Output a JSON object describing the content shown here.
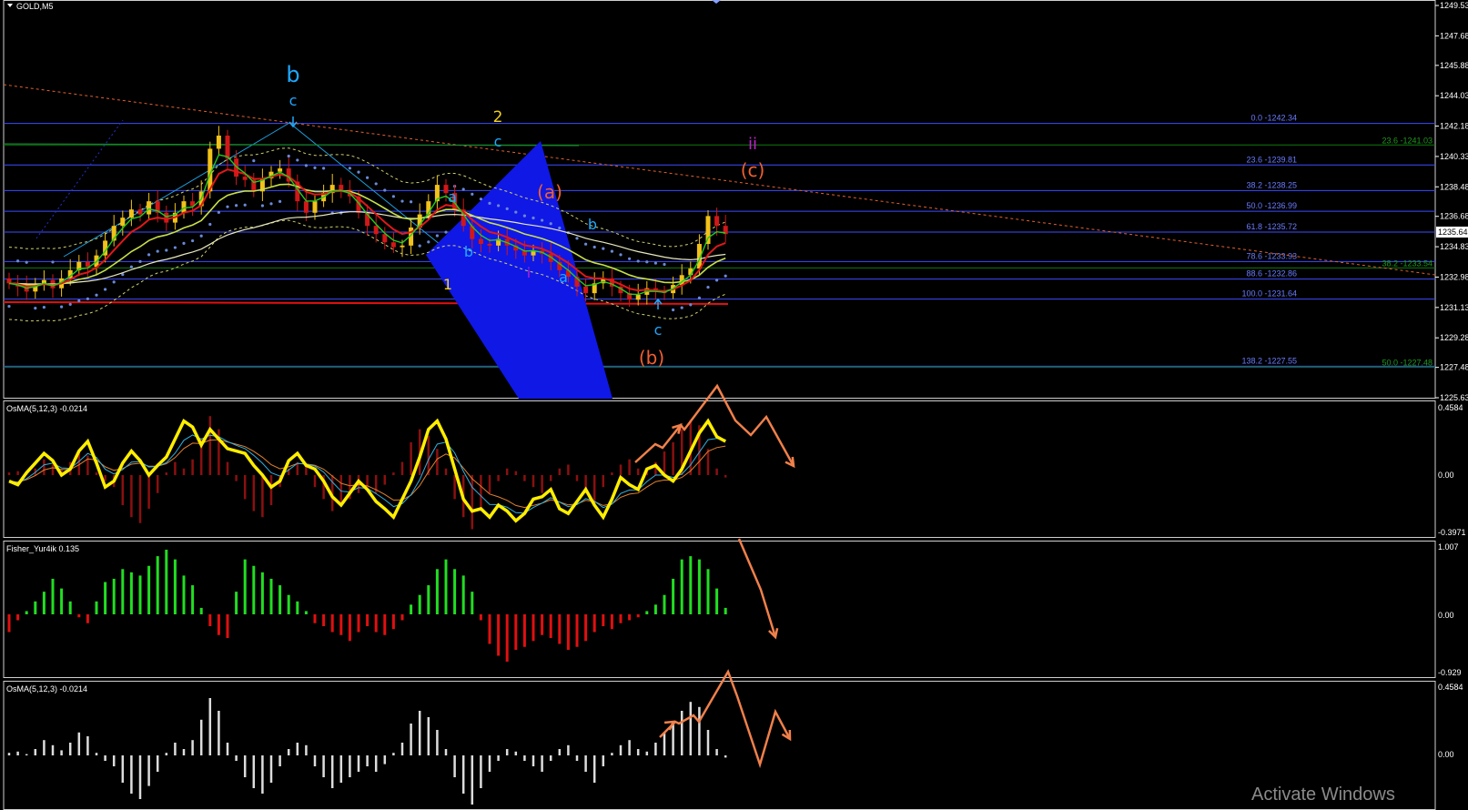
{
  "symbol_title": "GOLD,M5",
  "watermark": "Activate Windows",
  "colors": {
    "bull": "#f2c21a",
    "bear": "#d11818",
    "fib": "#3c4cff",
    "fib2": "#0f7a0f",
    "wedge": "#1018e6",
    "arrow": "#f0804a"
  },
  "main_pane": {
    "price_axis": [
      "1249.53",
      "1247.68",
      "1245.88",
      "1244.03",
      "1242.18",
      "1240.33",
      "1238.48",
      "1236.68",
      "1234.83",
      "1232.98",
      "1231.13",
      "1229.28",
      "1227.48",
      "1225.63"
    ],
    "current_price": "1235.64",
    "fib_levels": [
      {
        "label": "0.0 -1242.34",
        "price": 1242.34
      },
      {
        "label": "23.6 -1239.81",
        "price": 1239.81
      },
      {
        "label": "38.2 -1238.25",
        "price": 1238.25
      },
      {
        "label": "50.0 -1236.99",
        "price": 1236.99
      },
      {
        "label": "61.8 -1235.72",
        "price": 1235.72
      },
      {
        "label": "78.6 -1233.93",
        "price": 1233.93
      },
      {
        "label": "88.6 -1232.86",
        "price": 1232.86
      },
      {
        "label": "100.0 -1231.64",
        "price": 1231.64
      },
      {
        "label": "138.2 -1227.55",
        "price": 1227.55
      }
    ],
    "fib2_levels": [
      {
        "label": "23.6 -1241.03",
        "price": 1241.03
      },
      {
        "label": "38.2 -1233.54",
        "price": 1233.54
      },
      {
        "label": "50.0 -1227.48",
        "price": 1227.48
      }
    ],
    "wave_labels": {
      "b_big": "b",
      "c1": "c",
      "two": "2",
      "c2": "c",
      "a1": "a",
      "a_paren": "(a)",
      "b1": "b",
      "b2": "b",
      "i1": "i",
      "a2": "a",
      "one": "1",
      "ii": "ii",
      "c_paren": "(c)",
      "c3": "c",
      "b_paren": "(b)"
    }
  },
  "osma1": {
    "title": "OsMA(5,12,3) -0.0214",
    "axis": [
      "0.4584",
      "0.00",
      "-0.3971"
    ]
  },
  "fisher": {
    "title": "Fisher_Yur4ik 0.135",
    "axis": [
      "1.007",
      "0.00",
      "-0.929"
    ]
  },
  "osma2": {
    "title": "OsMA(5,12,3) -0.0214",
    "axis": [
      "0.4584",
      "0.00",
      "-0.3971"
    ]
  },
  "chart_data": {
    "type": "candlestick",
    "title": "GOLD,M5",
    "ylim": [
      1225.63,
      1249.53
    ],
    "close": [
      1232.6,
      1232.4,
      1232.1,
      1232.5,
      1232.8,
      1232.3,
      1232.9,
      1233.4,
      1233.9,
      1233.6,
      1234.3,
      1235.2,
      1236.1,
      1236.6,
      1237.1,
      1236.8,
      1237.6,
      1236.9,
      1236.3,
      1236.9,
      1237.6,
      1237.3,
      1238.2,
      1240.8,
      1241.6,
      1240.2,
      1239.1,
      1238.9,
      1238.2,
      1239.0,
      1239.4,
      1239.6,
      1238.8,
      1237.6,
      1236.9,
      1237.6,
      1238.1,
      1238.6,
      1238.3,
      1237.9,
      1236.9,
      1236.1,
      1235.6,
      1235.1,
      1234.8,
      1234.9,
      1236.0,
      1236.8,
      1237.6,
      1238.6,
      1238.1,
      1237.1,
      1236.1,
      1235.3,
      1235.0,
      1234.9,
      1235.3,
      1234.9,
      1234.6,
      1234.3,
      1234.6,
      1234.4,
      1233.9,
      1233.4,
      1233.0,
      1232.4,
      1232.0,
      1232.6,
      1232.9,
      1232.4,
      1232.0,
      1231.6,
      1231.9,
      1232.3,
      1232.1,
      1232.0,
      1232.5,
      1233.1,
      1233.5,
      1235.0,
      1236.7,
      1236.1,
      1235.6
    ],
    "fib_levels": [
      1242.34,
      1239.81,
      1238.25,
      1236.99,
      1235.72,
      1233.93,
      1232.86,
      1231.64,
      1227.55
    ],
    "fisher_values": [
      -0.3,
      -0.1,
      0.05,
      0.2,
      0.35,
      0.55,
      0.4,
      0.2,
      -0.05,
      -0.15,
      0.2,
      0.5,
      0.55,
      0.7,
      0.65,
      0.6,
      0.75,
      0.9,
      1.0,
      0.85,
      0.6,
      0.45,
      0.1,
      -0.2,
      -0.35,
      -0.4,
      0.35,
      0.85,
      0.75,
      0.65,
      0.55,
      0.45,
      0.3,
      0.2,
      0.05,
      -0.15,
      -0.2,
      -0.3,
      -0.35,
      -0.45,
      -0.3,
      -0.2,
      -0.3,
      -0.35,
      -0.25,
      -0.1,
      0.15,
      0.3,
      0.45,
      0.7,
      0.85,
      0.7,
      0.6,
      0.35,
      -0.1,
      -0.5,
      -0.7,
      -0.8,
      -0.6,
      -0.55,
      -0.45,
      -0.35,
      -0.4,
      -0.5,
      -0.6,
      -0.55,
      -0.45,
      -0.3,
      -0.2,
      -0.25,
      -0.15,
      -0.1,
      -0.05,
      0.05,
      0.15,
      0.3,
      0.55,
      0.85,
      0.9,
      0.85,
      0.7,
      0.4,
      0.1
    ],
    "osma_hist": [
      0.02,
      0.03,
      0.01,
      0.05,
      0.12,
      0.08,
      0.04,
      0.1,
      0.18,
      0.15,
      0.02,
      -0.05,
      -0.1,
      -0.25,
      -0.35,
      -0.4,
      -0.28,
      -0.15,
      0.02,
      0.1,
      0.05,
      0.12,
      0.28,
      0.45,
      0.35,
      0.1,
      -0.05,
      -0.2,
      -0.3,
      -0.35,
      -0.25,
      -0.1,
      0.05,
      0.1,
      0.08,
      -0.1,
      -0.2,
      -0.3,
      -0.25,
      -0.2,
      -0.15,
      -0.1,
      -0.15,
      -0.08,
      0.02,
      0.1,
      0.25,
      0.35,
      0.3,
      0.2,
      0.05,
      -0.2,
      -0.35,
      -0.45,
      -0.3,
      -0.15,
      -0.05,
      0.05,
      0.03,
      -0.05,
      -0.1,
      -0.15,
      -0.05,
      0.05,
      0.08,
      -0.05,
      -0.15,
      -0.25,
      -0.1,
      0.02,
      0.08,
      0.12,
      0.05,
      0.03,
      0.1,
      0.18,
      0.25,
      0.35,
      0.42,
      0.38,
      0.2,
      0.05,
      -0.02
    ],
    "osma_line": [
      -0.05,
      -0.08,
      0.02,
      0.1,
      0.18,
      0.12,
      0.0,
      0.05,
      0.2,
      0.28,
      0.1,
      -0.1,
      -0.05,
      0.1,
      0.2,
      0.12,
      0.0,
      0.08,
      0.15,
      0.3,
      0.45,
      0.4,
      0.25,
      0.38,
      0.3,
      0.22,
      0.2,
      0.18,
      0.08,
      0.0,
      -0.1,
      -0.05,
      0.12,
      0.18,
      0.08,
      0.05,
      -0.05,
      -0.18,
      -0.25,
      -0.15,
      -0.05,
      -0.12,
      -0.22,
      -0.28,
      -0.35,
      -0.2,
      -0.05,
      0.15,
      0.38,
      0.45,
      0.3,
      0.05,
      -0.2,
      -0.3,
      -0.28,
      -0.35,
      -0.25,
      -0.3,
      -0.38,
      -0.32,
      -0.2,
      -0.18,
      -0.12,
      -0.28,
      -0.32,
      -0.22,
      -0.12,
      -0.25,
      -0.35,
      -0.2,
      -0.02,
      -0.08,
      -0.12,
      0.05,
      0.08,
      0.0,
      -0.05,
      0.05,
      0.2,
      0.35,
      0.45,
      0.32,
      0.28
    ]
  }
}
